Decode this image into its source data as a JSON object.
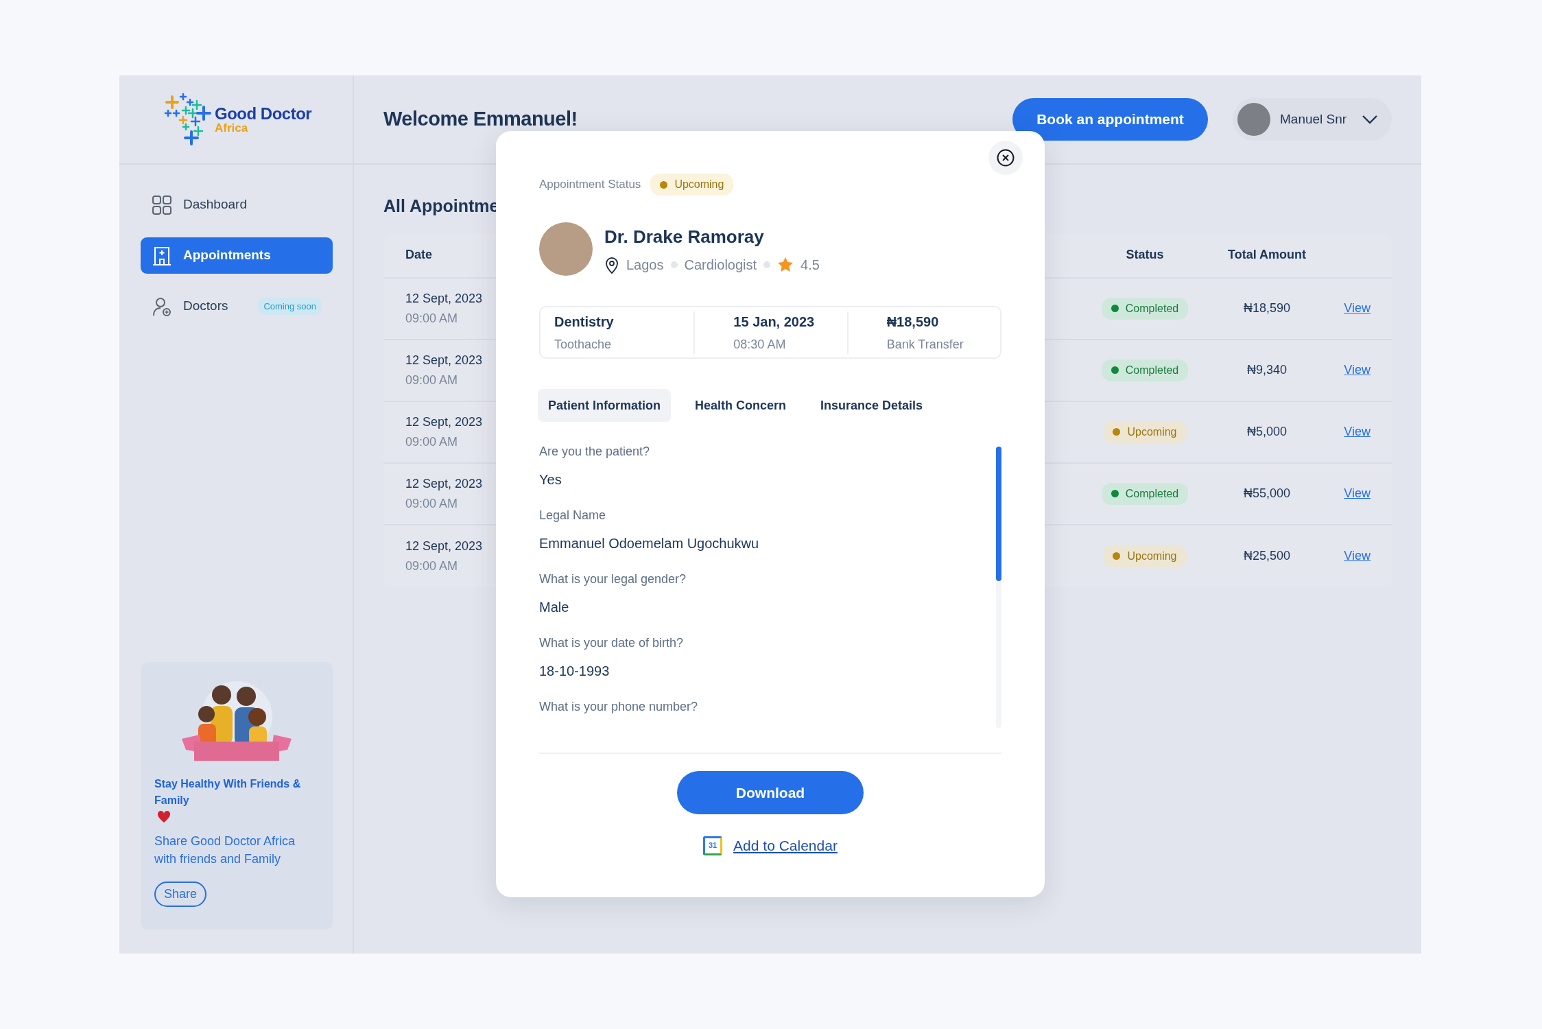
{
  "sidebar": {
    "logo": {
      "name": "Good Doctor",
      "tagline": "Africa"
    },
    "nav": [
      {
        "label": "Dashboard",
        "selected": false
      },
      {
        "label": "Appointments",
        "selected": true
      },
      {
        "label": "Doctors",
        "selected": false,
        "badge": "Coming soon"
      }
    ],
    "promo": {
      "title": "Stay Healthy With Friends & Family",
      "text": "Share Good Doctor Africa with friends and Family",
      "button": "Share"
    }
  },
  "header": {
    "greeting": "Welcome Emmanuel!",
    "book_button": "Book an appointment",
    "user": {
      "name": "Manuel Snr"
    }
  },
  "appointments": {
    "title": "All Appointme",
    "columns": [
      "Date",
      "Status",
      "Total Amount"
    ],
    "rows": [
      {
        "date": "12 Sept, 2023",
        "time": "09:00 AM",
        "status": {
          "label": "Completed",
          "kind": "completed"
        },
        "amount": "₦18,590",
        "action": "View"
      },
      {
        "date": "12 Sept, 2023",
        "time": "09:00 AM",
        "status": {
          "label": "Completed",
          "kind": "completed"
        },
        "amount": "₦9,340",
        "action": "View"
      },
      {
        "date": "12 Sept, 2023",
        "time": "09:00 AM",
        "status": {
          "label": "Upcoming",
          "kind": "upcoming"
        },
        "amount": "₦5,000",
        "action": "View"
      },
      {
        "date": "12 Sept, 2023",
        "time": "09:00 AM",
        "status": {
          "label": "Completed",
          "kind": "completed"
        },
        "amount": "₦55,000",
        "action": "View"
      },
      {
        "date": "12 Sept, 2023",
        "time": "09:00 AM",
        "status": {
          "label": "Upcoming",
          "kind": "upcoming"
        },
        "amount": "₦25,500",
        "action": "View"
      }
    ]
  },
  "modal": {
    "status_label": "Appointment Status",
    "status": {
      "label": "Upcoming",
      "kind": "upcoming"
    },
    "doctor": {
      "name": "Dr. Drake Ramoray",
      "location": "Lagos",
      "specialty": "Cardiologist",
      "rating": "4.5"
    },
    "summary": [
      {
        "title": "Dentistry",
        "subtitle": "Toothache"
      },
      {
        "title": "15 Jan, 2023",
        "subtitle": "08:30 AM"
      },
      {
        "title": "₦18,590",
        "subtitle": "Bank Transfer"
      }
    ],
    "tabs": [
      {
        "label": "Patient Information",
        "selected": true
      },
      {
        "label": "Health Concern",
        "selected": false
      },
      {
        "label": "Insurance Details",
        "selected": false
      }
    ],
    "fields": [
      {
        "question": "Are you the patient?",
        "answer": "Yes"
      },
      {
        "question": "Legal Name",
        "answer": "Emmanuel Odoemelam Ugochukwu"
      },
      {
        "question": "What is your legal gender?",
        "answer": "Male"
      },
      {
        "question": "What is your date of birth?",
        "answer": "18-10-1993"
      },
      {
        "question": "What is your phone number?"
      }
    ],
    "download_button": "Download",
    "calendar_icon_label": "31",
    "calendar_link": "Add to Calendar"
  }
}
